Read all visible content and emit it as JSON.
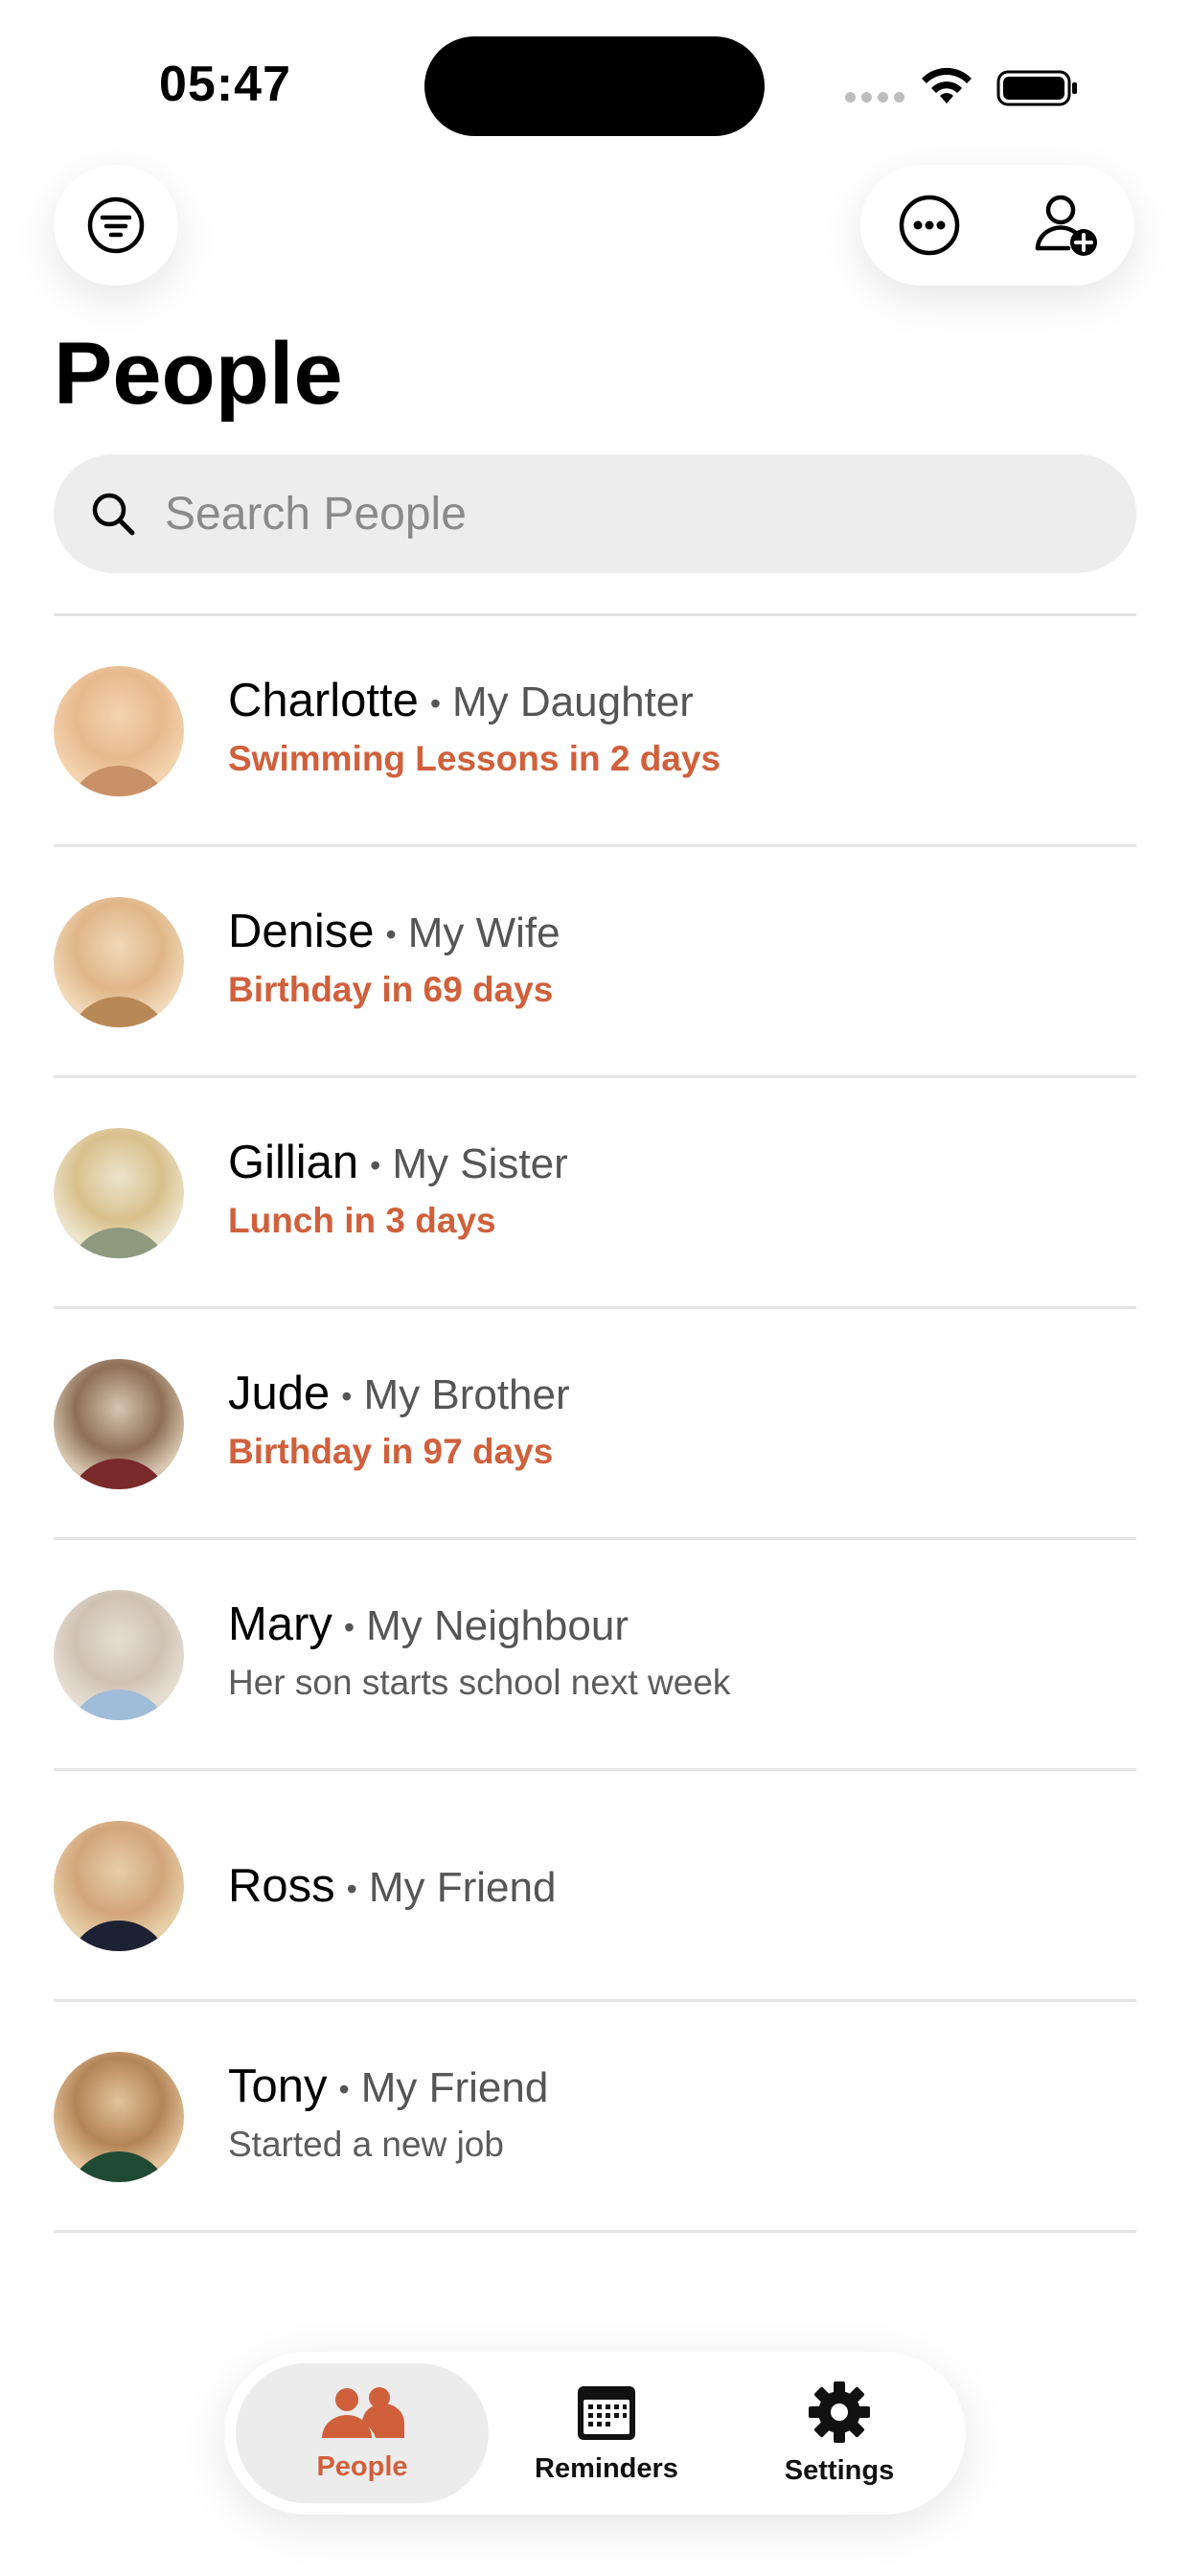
{
  "status_bar": {
    "time": "05:47"
  },
  "header": {
    "title": "People"
  },
  "search": {
    "placeholder": "Search People",
    "value": ""
  },
  "people": [
    {
      "name": "Charlotte",
      "relation": "My Daughter",
      "note": "Swimming Lessons in 2 days",
      "note_style": "accent",
      "avatar_colors": [
        "#f3d3ae",
        "#e8b98f",
        "#c99167"
      ]
    },
    {
      "name": "Denise",
      "relation": "My Wife",
      "note": "Birthday in 69 days",
      "note_style": "accent",
      "avatar_colors": [
        "#f0d8b8",
        "#e0b689",
        "#b98857"
      ]
    },
    {
      "name": "Gillian",
      "relation": "My Sister",
      "note": "Lunch in 3 days",
      "note_style": "accent",
      "avatar_colors": [
        "#ece4cc",
        "#d9c08d",
        "#8d9a7e"
      ]
    },
    {
      "name": "Jude",
      "relation": "My Brother",
      "note": "Birthday in 97 days",
      "note_style": "accent",
      "avatar_colors": [
        "#d7c6b0",
        "#8e6f57",
        "#7a2a2a"
      ]
    },
    {
      "name": "Mary",
      "relation": "My Neighbour",
      "note": "Her son starts school next week",
      "note_style": "muted",
      "avatar_colors": [
        "#e6ddd2",
        "#cfc2b3",
        "#9fbcd8"
      ]
    },
    {
      "name": "Ross",
      "relation": "My Friend",
      "note": "",
      "note_style": "muted",
      "avatar_colors": [
        "#e7cfa8",
        "#d2a57b",
        "#1c2233"
      ]
    },
    {
      "name": "Tony",
      "relation": "My Friend",
      "note": "Started a new job",
      "note_style": "muted",
      "avatar_colors": [
        "#e2c39a",
        "#b48457",
        "#1f4a33"
      ]
    }
  ],
  "tabs": [
    {
      "label": "People",
      "icon": "people-icon",
      "active": true
    },
    {
      "label": "Reminders",
      "icon": "calendar-icon",
      "active": false
    },
    {
      "label": "Settings",
      "icon": "gear-icon",
      "active": false
    }
  ],
  "colors": {
    "accent": "#d0603c",
    "muted_text": "#5c5c5c",
    "divider": "#e4e4e4",
    "search_bg": "#ededed"
  }
}
